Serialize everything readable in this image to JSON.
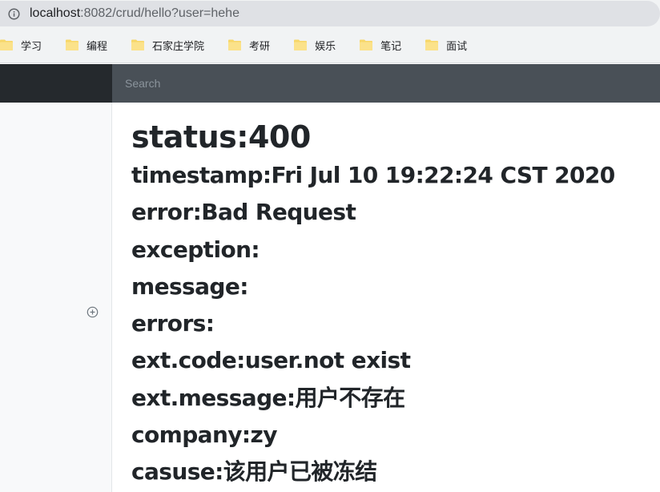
{
  "browser": {
    "url_host": "localhost",
    "url_rest": ":8082/crud/hello?user=hehe",
    "info_icon": "info-circle-icon"
  },
  "bookmarks": [
    {
      "label": "学习",
      "icon": "folder-icon"
    },
    {
      "label": "编程",
      "icon": "folder-icon"
    },
    {
      "label": "石家庄学院",
      "icon": "folder-icon"
    },
    {
      "label": "考研",
      "icon": "folder-icon"
    },
    {
      "label": "娱乐",
      "icon": "folder-icon"
    },
    {
      "label": "笔记",
      "icon": "folder-icon"
    },
    {
      "label": "面试",
      "icon": "folder-icon"
    }
  ],
  "navbar": {
    "search_placeholder": "Search"
  },
  "sidebar": {
    "add_icon": "plus-circle-icon"
  },
  "main": {
    "status": "status:400",
    "lines": [
      "timestamp:Fri Jul 10 19:22:24 CST 2020",
      "error:Bad Request",
      "exception:",
      "message:",
      "errors:",
      "ext.code:user.not exist",
      "ext.message:用户不存在",
      "company:zy",
      "casuse:该用户已被冻结"
    ]
  },
  "colors": {
    "navbar": "#343a40",
    "brand": "#25292d",
    "search_bg": "#495057",
    "sidebar": "#f8f9fa",
    "folder": "#f7d768"
  }
}
